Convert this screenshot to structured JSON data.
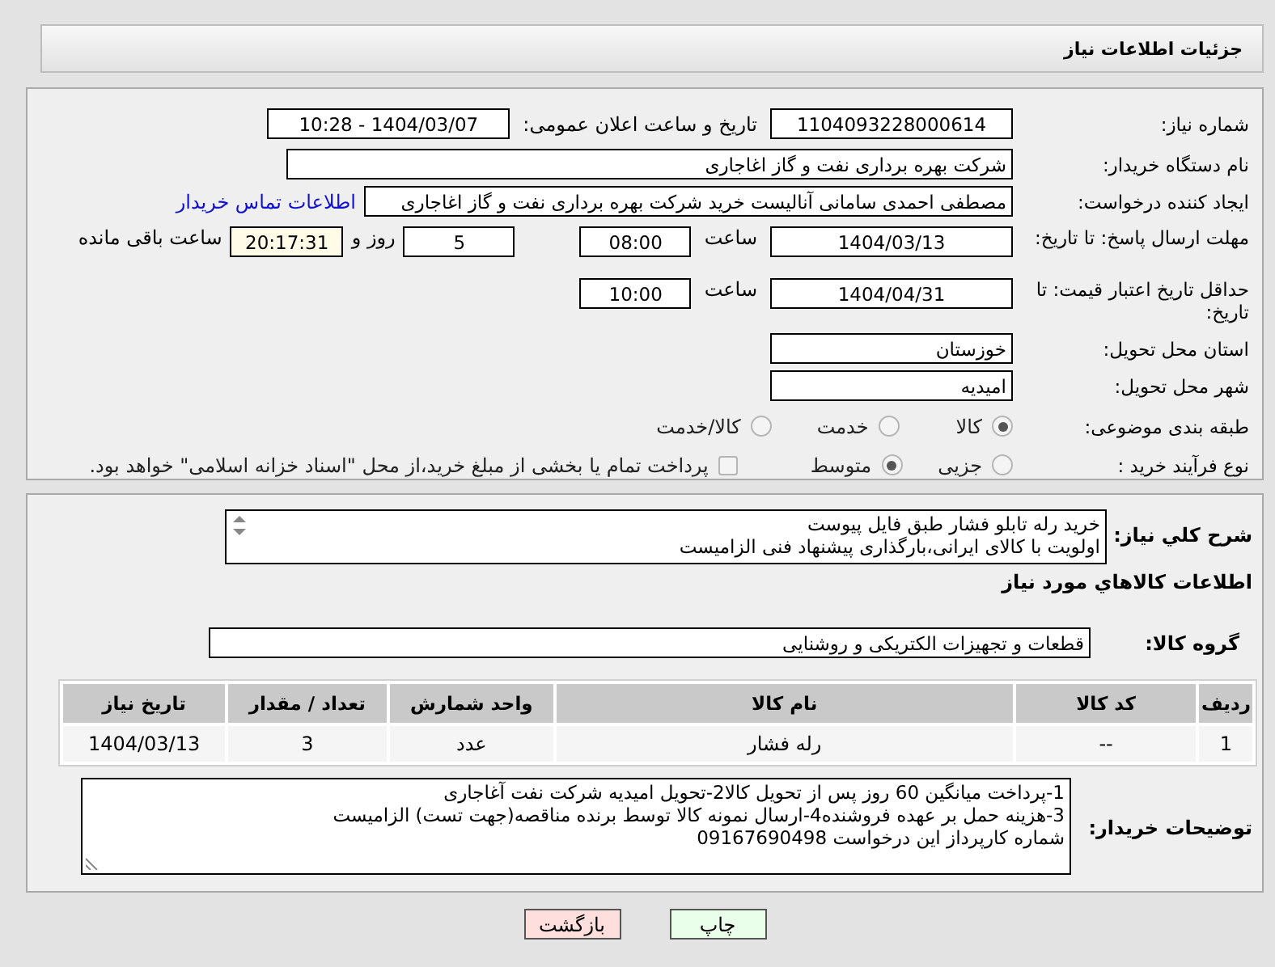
{
  "header": {
    "title": "جزئیات اطلاعات نیاز"
  },
  "need_number": {
    "label": "شماره نیاز:",
    "value": "1104093228000614"
  },
  "announce": {
    "label": "تاریخ و ساعت اعلان عمومی:",
    "value": "1404/03/07 - 10:28"
  },
  "buyer": {
    "label": "نام دستگاه خریدار:",
    "value": "شرکت بهره برداری نفت و گاز اغاجاری"
  },
  "creator": {
    "label": "ایجاد کننده درخواست:",
    "value": "مصطفی احمدی سامانی آنالیست خرید شرکت بهره برداری نفت و گاز اغاجاری",
    "link": "اطلاعات تماس خریدار"
  },
  "deadline": {
    "label": "مهلت ارسال پاسخ: تا تاریخ:",
    "date": "1404/03/13",
    "time_label": "ساعت",
    "time": "08:00",
    "days": "5",
    "days_label": "روز و",
    "remaining": "20:17:31",
    "remaining_label": "ساعت باقی مانده"
  },
  "validity": {
    "label": "حداقل تاریخ اعتبار قیمت: تا تاریخ:",
    "date": "1404/04/31",
    "time_label": "ساعت",
    "time": "10:00"
  },
  "province": {
    "label": "استان محل تحویل:",
    "value": "خوزستان"
  },
  "city": {
    "label": "شهر محل تحویل:",
    "value": "امیدیه"
  },
  "category": {
    "label": "طبقه بندی موضوعی:",
    "options": [
      {
        "label": "کالا",
        "selected": true
      },
      {
        "label": "خدمت",
        "selected": false
      },
      {
        "label": "کالا/خدمت",
        "selected": false
      }
    ]
  },
  "process": {
    "label": "نوع فرآیند خرید :",
    "options": [
      {
        "label": "جزیی",
        "selected": false
      },
      {
        "label": "متوسط",
        "selected": true
      }
    ],
    "checkbox": {
      "label": "پرداخت تمام یا بخشی از مبلغ خرید،از محل \"اسناد خزانه اسلامی\" خواهد بود.",
      "checked": false
    }
  },
  "description": {
    "label": "شرح کلي نياز:",
    "lines": [
      "خرید رله تابلو فشار طبق فایل پیوست",
      "اولویت با کالای ایرانی،بارگذاری پیشنهاد فنی الزامیست"
    ]
  },
  "goods_heading": "اطلاعات كالاهاي مورد نياز",
  "group": {
    "label": "گروه کالا:",
    "value": "قطعات و تجهیزات الکتریکی و روشنایی"
  },
  "table": {
    "columns": [
      "ردیف",
      "کد کالا",
      "نام کالا",
      "واحد شمارش",
      "تعداد / مقدار",
      "تاریخ نیاز"
    ],
    "rows": [
      [
        "1",
        "--",
        "رله فشار",
        "عدد",
        "3",
        "1404/03/13"
      ]
    ]
  },
  "notes": {
    "label": "توضیحات خریدار:",
    "lines": [
      "1-پرداخت میانگین 60 روز پس از تحویل کالا2-تحویل امیدیه شرکت نفت آغاجاری",
      "3-هزینه حمل بر عهده فروشنده4-ارسال نمونه کالا توسط برنده مناقصه(جهت تست) الزامیست",
      "شماره کارپرداز این درخواست 09167690498"
    ]
  },
  "buttons": [
    {
      "label": "چاپ",
      "kind": "print"
    },
    {
      "label": "بازگشت",
      "kind": "back"
    }
  ]
}
